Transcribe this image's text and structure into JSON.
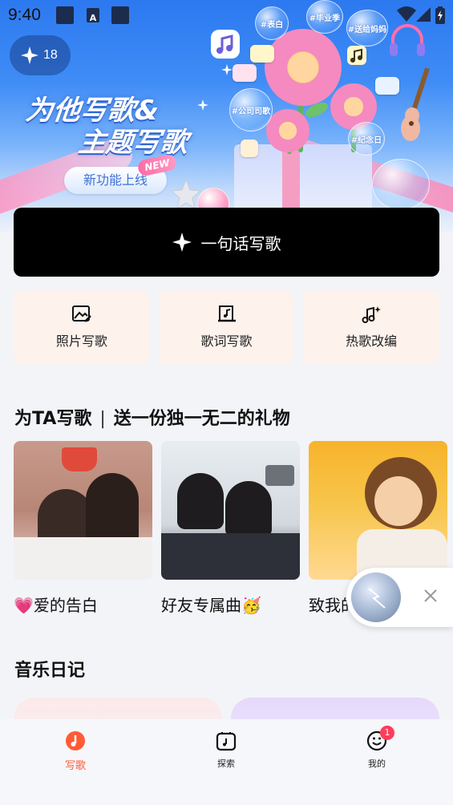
{
  "status_bar": {
    "time": "9:40",
    "notif_letter": "A"
  },
  "banner": {
    "credits": "18",
    "headline_line1": "为他写歌&",
    "headline_line2": "主题写歌",
    "new_feature_label": "新功能上线",
    "new_tag": "NEW",
    "tags": [
      "#表白",
      "#毕业季",
      "#送给妈妈",
      "#公司司歌",
      "#纪念日"
    ]
  },
  "main_action": {
    "label": "一句话写歌"
  },
  "tools": [
    {
      "label": "照片写歌",
      "icon": "image-edit-icon"
    },
    {
      "label": "歌词写歌",
      "icon": "lyrics-note-icon"
    },
    {
      "label": "热歌改编",
      "icon": "music-sparkle-icon"
    }
  ],
  "section_ta": {
    "title": "为TA写歌",
    "subtitle": "送一份独一无二的礼物"
  },
  "cards": [
    {
      "caption": "爱的告白",
      "emoji": "💗"
    },
    {
      "caption": "好友专属曲",
      "emoji": "🥳"
    },
    {
      "caption": "致我的",
      "emoji": ""
    }
  ],
  "section_diary": {
    "title": "音乐日记"
  },
  "tabbar": [
    {
      "label": "写歌",
      "icon": "music-note-icon",
      "active": true
    },
    {
      "label": "探索",
      "icon": "explore-icon",
      "active": false
    },
    {
      "label": "我的",
      "icon": "profile-smile-icon",
      "active": false,
      "badge": "1"
    }
  ],
  "colors": {
    "accent": "#ff5b36",
    "button_bg": "#000000",
    "tool_bg": "#fdf2ec"
  }
}
